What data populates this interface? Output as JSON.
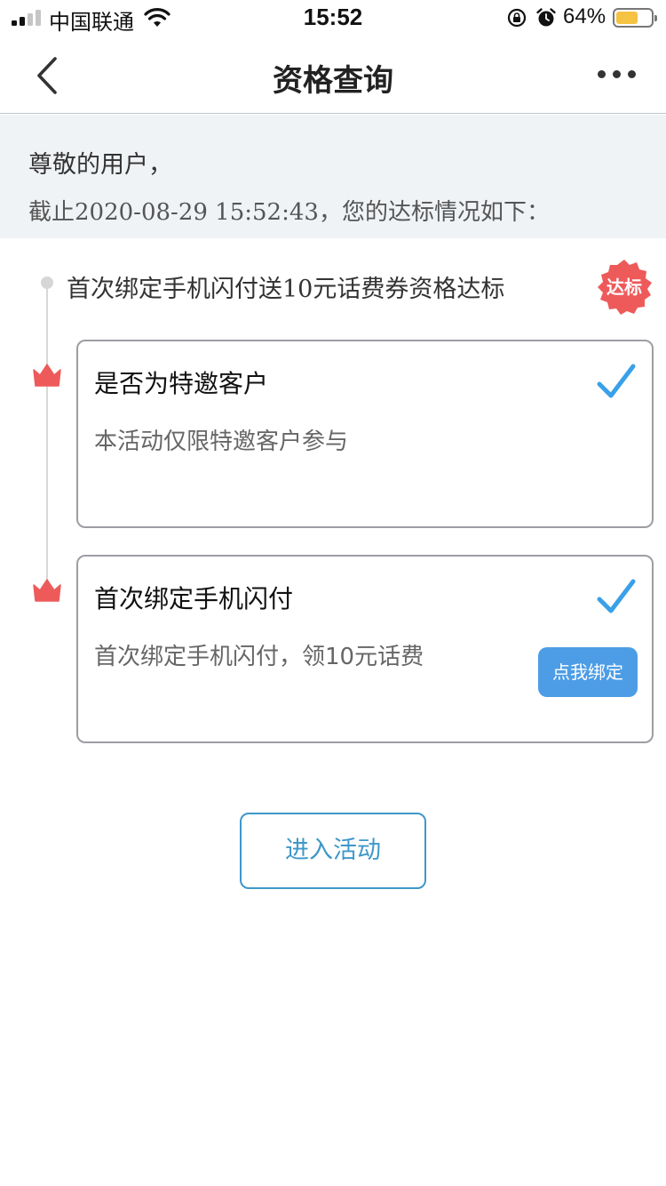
{
  "status_bar": {
    "carrier": "中国联通",
    "time": "15:52",
    "battery_percent": "64%",
    "battery_level": 0.64,
    "signal_bars_active": 2,
    "battery_color": "#f5c342",
    "icons": [
      "signal-icon",
      "wifi-icon",
      "rotation-lock-icon",
      "alarm-icon",
      "battery-icon"
    ]
  },
  "nav": {
    "title": "资格查询",
    "back_icon": "chevron-left-icon",
    "more_icon": "more-dots-icon"
  },
  "info": {
    "greeting": "尊敬的用户，",
    "status_line": "截止2020-08-29 15:52:43，您的达标情况如下："
  },
  "condition": {
    "title": "首次绑定手机闪付送10元话费券资格达标",
    "badge": "达标",
    "badge_color": "#ee5a5a"
  },
  "cards": [
    {
      "title": "是否为特邀客户",
      "desc": "本活动仅限特邀客户参与",
      "checked": true
    },
    {
      "title": "首次绑定手机闪付",
      "desc": "首次绑定手机闪付，领10元话费",
      "checked": true,
      "button": "点我绑定"
    }
  ],
  "colors": {
    "accent_blue": "#4c9de6",
    "check_blue": "#3aa0e8",
    "crown_red": "#ee5a5a",
    "enter_button": "#3d98c9"
  },
  "enter_button": "进入活动"
}
